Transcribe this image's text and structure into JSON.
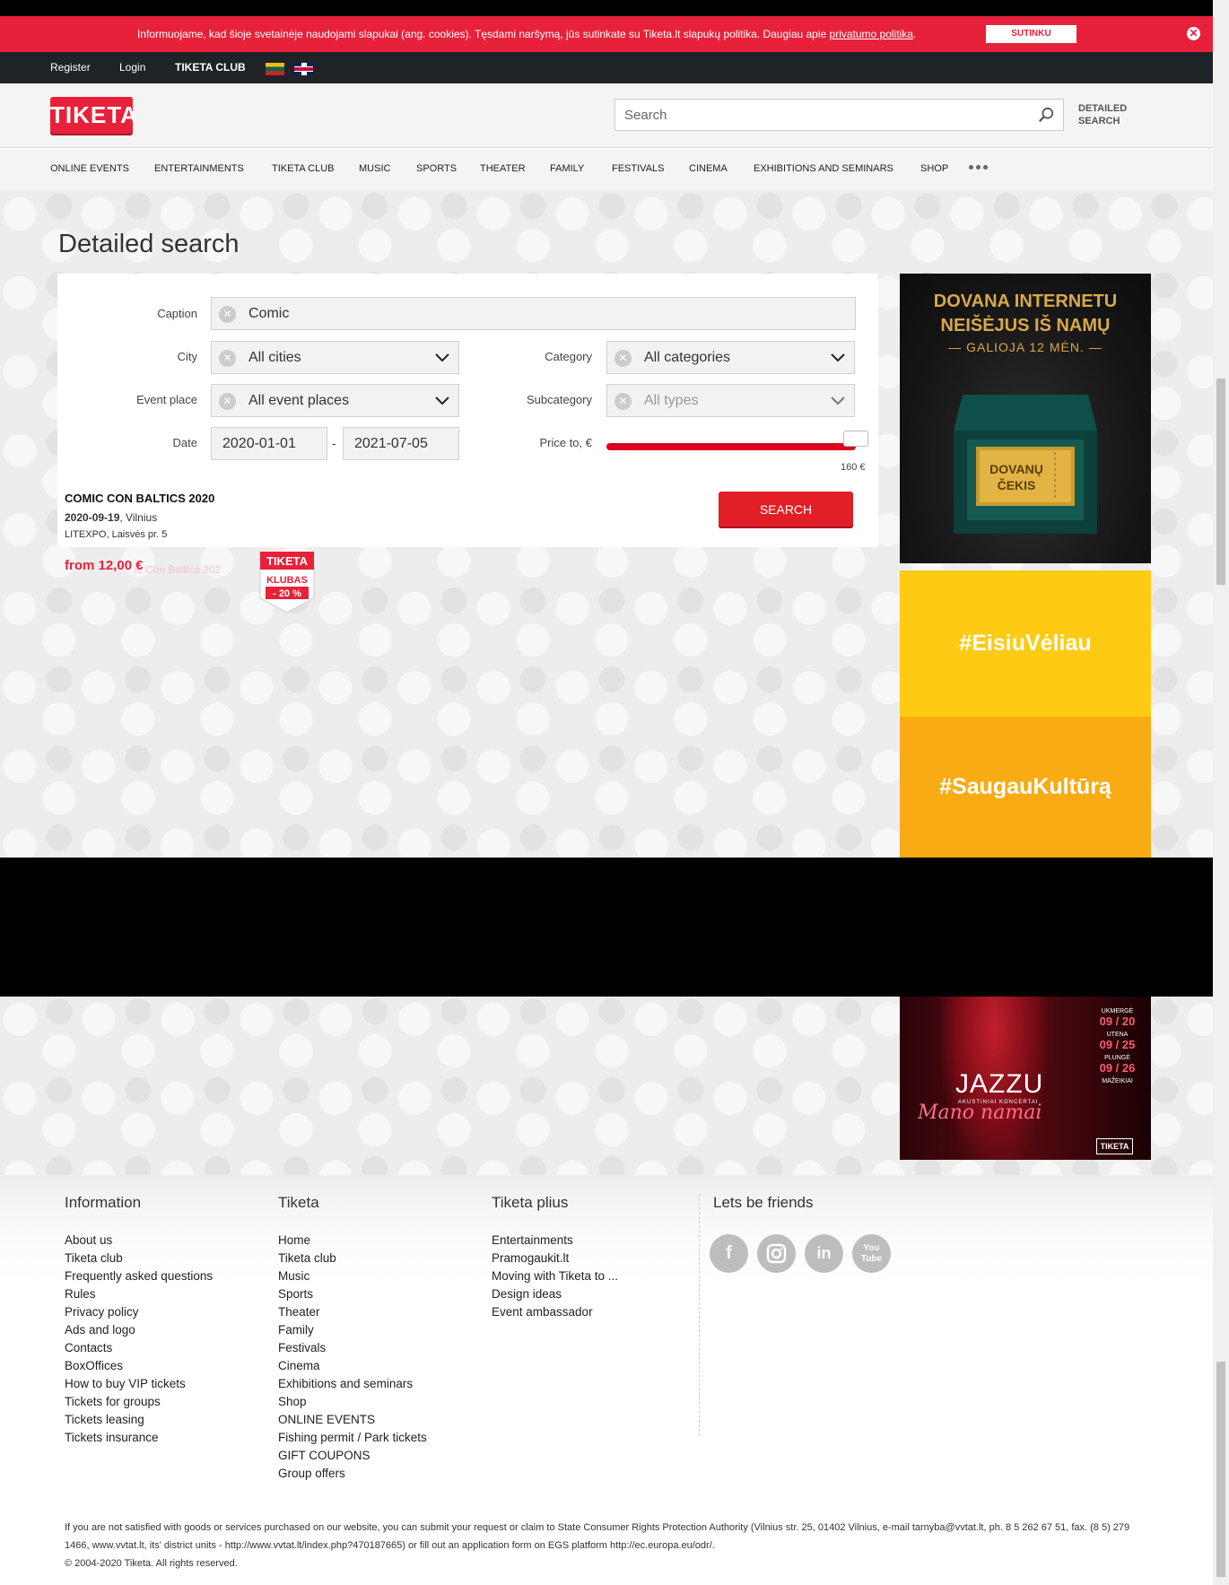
{
  "cookie": {
    "message": "Informuojame, kad šioje svetainėje naudojami slapukai (ang. cookies). Tęsdami naršymą, jūs sutinkate su Tiketa.lt slapukų politika. Daugiau apie",
    "link": "privatumo politika",
    "period": ".",
    "accept": "SUTINKU",
    "close": "✕"
  },
  "topbar": {
    "register": "Register",
    "login": "Login",
    "club": "TIKETA CLUB"
  },
  "header": {
    "logo": "TIKETA",
    "search_placeholder": "Search",
    "detailed_search": "DETAILED SEARCH"
  },
  "nav": {
    "items": [
      "ONLINE EVENTS",
      "ENTERTAINMENTS",
      "TIKETA CLUB",
      "MUSIC",
      "SPORTS",
      "THEATER",
      "FAMILY",
      "FESTIVALS",
      "CINEMA",
      "EXHIBITIONS AND SEMINARS",
      "SHOP"
    ]
  },
  "search_form": {
    "title": "Detailed search",
    "caption_label": "Caption",
    "caption_value": "Comic",
    "city_label": "City",
    "city_value": "All cities",
    "category_label": "Category",
    "category_value": "All categories",
    "event_place_label": "Event place",
    "event_place_value": "All event places",
    "subcategory_label": "Subcategory",
    "subcategory_value": "All types",
    "date_label": "Date",
    "date_from": "2020-01-01",
    "date_sep": "-",
    "date_to": "2021-07-05",
    "price_label": "Price to, €",
    "price_max": "160 €",
    "price_fraction": 1.0,
    "search_button": "SEARCH"
  },
  "result": {
    "title": "COMIC CON BALTICS 2020",
    "date": "2020-09-19",
    "city": ", Vilnius",
    "place": "LITEXPO, Laisvės pr. 5",
    "price": "from 12,00 €",
    "ghost": "ic Con Baltics 202",
    "badge_brand": "TIKETA",
    "badge_club": "KLUBAS",
    "badge_discount": "- 20 %"
  },
  "ads": {
    "ad1_line1": "DOVANA INTERNETU",
    "ad1_line2": "NEIŠĖJUS IŠ NAMŲ",
    "ad1_line3": "— GALIOJA 12 MĖN. —",
    "ad1_ticket1": "DOVANŲ",
    "ad1_ticket2": "ČEKIS",
    "ad2": "#EisiuVėliau",
    "ad3": "#SaugauKultūrą",
    "ad4_name": "JAZZU",
    "ad4_sub": "AKUSTINIAI KONCERTAI",
    "ad4_script": "Mano namai",
    "ad4_dates": [
      {
        "city": "UKMERGĖ",
        "date": "09 / 20"
      },
      {
        "city": "UTENA",
        "date": "09 / 25"
      },
      {
        "city": "PLUNGĖ",
        "date": "09 / 26"
      },
      {
        "city": "MAŽEIKIAI",
        "date": ""
      }
    ],
    "ad4_logo": "TIKETA"
  },
  "footer": {
    "info_title": "Information",
    "info_links": [
      "About us",
      "Tiketa club",
      "Frequently asked questions",
      "Rules",
      "Privacy policy",
      "Ads and logo",
      "Contacts",
      "BoxOffices",
      "How to buy VIP tickets",
      "Tickets for groups",
      "Tickets leasing",
      "Tickets insurance"
    ],
    "tiketa_title": "Tiketa",
    "tiketa_links": [
      "Home",
      "Tiketa club",
      "Music",
      "Sports",
      "Theater",
      "Family",
      "Festivals",
      "Cinema",
      "Exhibitions and seminars",
      "Shop",
      "ONLINE EVENTS",
      "Fishing permit / Park tickets",
      "GIFT COUPONS",
      "Group offers"
    ],
    "plius_title": "Tiketa plius",
    "plius_links": [
      "Entertainments",
      "Pramogaukit.lt",
      "Moving with Tiketa to ...",
      "Design ideas",
      "Event ambassador"
    ],
    "social_title": "Lets be friends",
    "legal": "If you are not satisfied with goods or services purchased on our website, you can submit your request or claim to State Consumer Rights Protection Authority (Vilnius str. 25, 01402 Vilnius, e-mail tarnyba@vvtat.lt, ph. 8 5 262 67 51, fax. (8 5) 279 1466, www.vvtat.lt, its' district units - http://www.vvtat.lt/index.php?470187665) or fill out an application form on EGS platform http://ec.europa.eu/odr/.",
    "copyright": "© 2004-2020 Tiketa. All rights reserved."
  }
}
